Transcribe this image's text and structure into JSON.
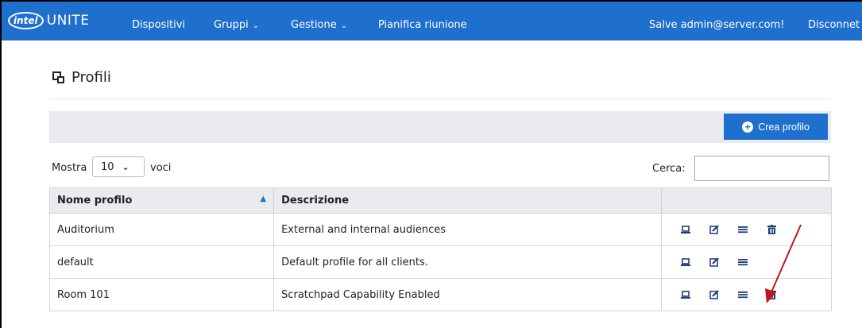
{
  "header": {
    "logo_intel": "intel",
    "logo_app": "UNITE",
    "nav": [
      {
        "label": "Dispositivi",
        "dropdown": false
      },
      {
        "label": "Gruppi",
        "dropdown": true
      },
      {
        "label": "Gestione",
        "dropdown": true
      },
      {
        "label": "Pianifica riunione",
        "dropdown": false
      }
    ],
    "greeting": "Salve admin@server.com!",
    "logout_label": "Disconnet"
  },
  "page": {
    "title": "Profili",
    "title_icon": "clone-icon"
  },
  "toolbar": {
    "create_label": "Crea profilo",
    "create_icon": "plus-circle-icon"
  },
  "table_controls": {
    "length_prefix": "Mostra",
    "length_value": "10",
    "length_suffix": "voci",
    "search_label": "Cerca:",
    "search_value": ""
  },
  "table": {
    "columns": [
      "Nome profilo",
      "Descrizione",
      ""
    ],
    "sorted_column": "Nome profilo",
    "sort_direction": "ascending",
    "rows": [
      {
        "name": "Auditorium",
        "description": "External and internal audiences",
        "actions": [
          "laptop-icon",
          "edit-icon",
          "list-icon",
          "trash-icon"
        ]
      },
      {
        "name": "default",
        "description": "Default profile for all clients.",
        "actions": [
          "laptop-icon",
          "edit-icon",
          "list-icon"
        ]
      },
      {
        "name": "Room 101",
        "description": "Scratchpad Capability Enabled",
        "actions": [
          "laptop-icon",
          "edit-icon",
          "list-icon",
          "trash-icon"
        ]
      }
    ]
  },
  "colors": {
    "brand_blue": "#1f6fce",
    "header_grey": "#e9ebef",
    "annotation_red": "#c0161b"
  }
}
